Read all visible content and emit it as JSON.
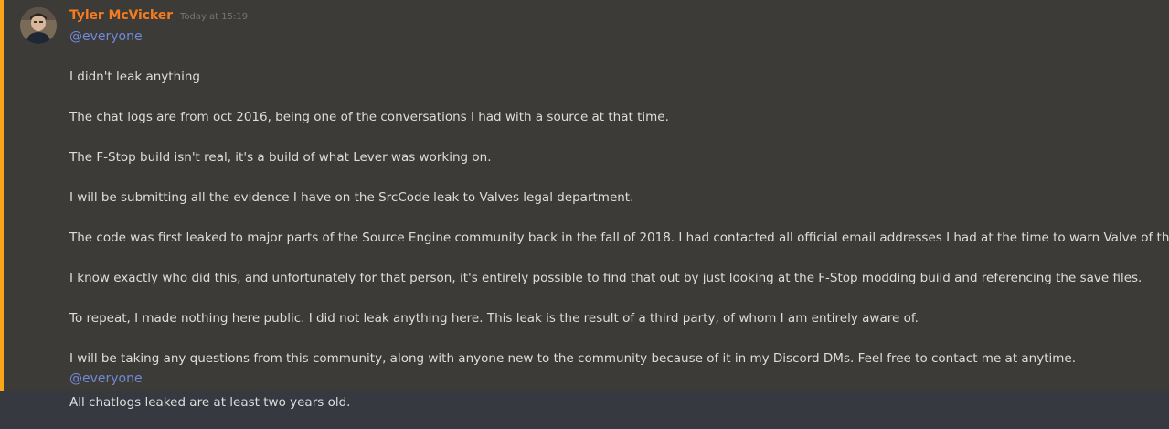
{
  "message": {
    "author": "Tyler McVicker",
    "timestamp": "Today at 15:19",
    "mention_top": "@everyone",
    "lines": [
      "I didn't leak anything",
      "The chat logs are from oct 2016, being one of the conversations I had with a source at that time.",
      "The F-Stop build isn't real, it's a build of what Lever was working on.",
      "I will be submitting all the evidence I have on the SrcCode leak to Valves legal department.",
      "The code was first leaked to major parts of the Source Engine community back in the fall of 2018. I had contacted all official email addresses I had at the time to warn Valve of this.",
      "I know exactly who did this, and unfortunately for that person, it's entirely possible to find that out by just looking at the F-Stop modding build and referencing the save files.",
      "To repeat, I made nothing here public. I did not leak anything here. This leak is the result of a third party, of whom I am entirely aware of.",
      "I will be taking any questions from this community, along with anyone new to the community because of it in my Discord DMs. Feel free to contact me at anytime."
    ],
    "mention_bottom": "@everyone"
  },
  "followup": {
    "text": "All chatlogs leaked are at least two years old."
  },
  "colors": {
    "background": "#36393f",
    "mention_highlight_bg": "#3c3b37",
    "mention_bar": "#faa61a",
    "username": "#f47b1f",
    "mention_text": "#7289da",
    "body_text": "#dcddde",
    "timestamp": "#72767d"
  }
}
